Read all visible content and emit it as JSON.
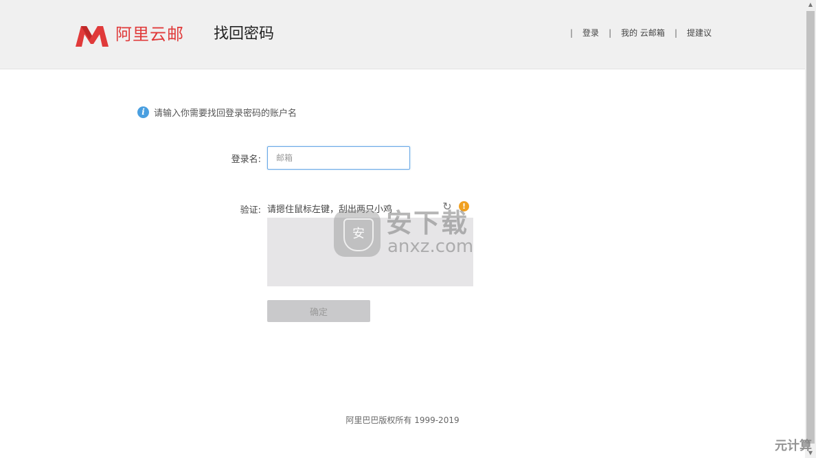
{
  "header": {
    "logo_text": "阿里云邮",
    "page_title": "找回密码",
    "nav": {
      "login": "登录",
      "my_mailbox": "我的 云邮箱",
      "feedback": "提建议",
      "separator": "|"
    }
  },
  "form": {
    "info_text": "请输入你需要找回登录密码的账户名",
    "login_label": "登录名:",
    "login_placeholder": "邮箱",
    "login_value": "",
    "verify_label": "验证:",
    "verify_hint": "请摁住鼠标左键，刮出两只小鸡",
    "confirm_label": "确定"
  },
  "watermark": {
    "cn": "安下载",
    "en": "anxz.com",
    "shield_char": "安"
  },
  "footer": {
    "copyright": "阿里巴巴版权所有 1999-2019"
  },
  "corner_mark": "元计算",
  "colors": {
    "brand_red": "#e03a3a",
    "info_blue": "#4a9fe0",
    "warn_orange": "#f0a020",
    "input_focus": "#6aa8e6"
  },
  "icons": {
    "info": "info-icon",
    "refresh": "refresh-icon",
    "warning": "warning-icon"
  }
}
